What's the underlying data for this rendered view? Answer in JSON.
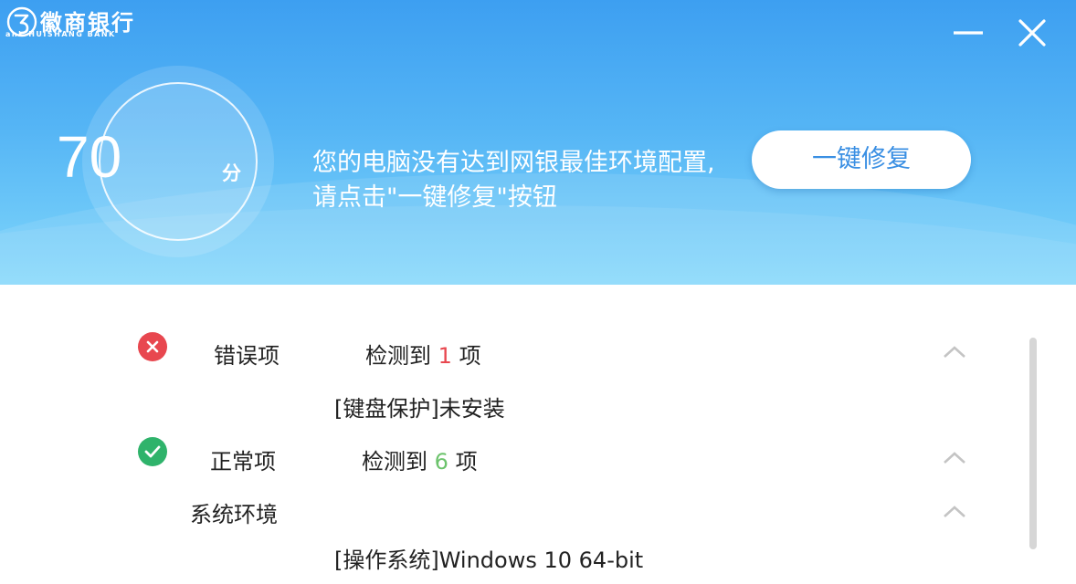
{
  "app": {
    "name": "徽商银行",
    "name_en": "ank HUISHANG BANK"
  },
  "colors": {
    "accent": "#3a8fe3",
    "error": "#e8474f",
    "ok": "#2fb36b",
    "error_count": "#e8474f",
    "ok_count": "#6cc36c"
  },
  "window": {
    "minimize_icon": "minimize-icon",
    "close_icon": "close-icon"
  },
  "score": {
    "value": "70",
    "unit": "分"
  },
  "message": {
    "line1": "您的电脑没有达到网银最佳环境配置,",
    "line2": "请点击\"一键修复\"按钮"
  },
  "fix_button": "一键修复",
  "results": {
    "error": {
      "icon": "error-icon",
      "label": "错误项",
      "prefix": "检测到",
      "count": "1",
      "suffix": "项",
      "items": [
        "[键盘保护]未安装"
      ]
    },
    "normal": {
      "icon": "check-icon",
      "label": "正常项",
      "prefix": "检测到",
      "count": "6",
      "suffix": "项",
      "group": "系统环境",
      "items": [
        "[操作系统]Windows 10 64-bit"
      ]
    }
  }
}
